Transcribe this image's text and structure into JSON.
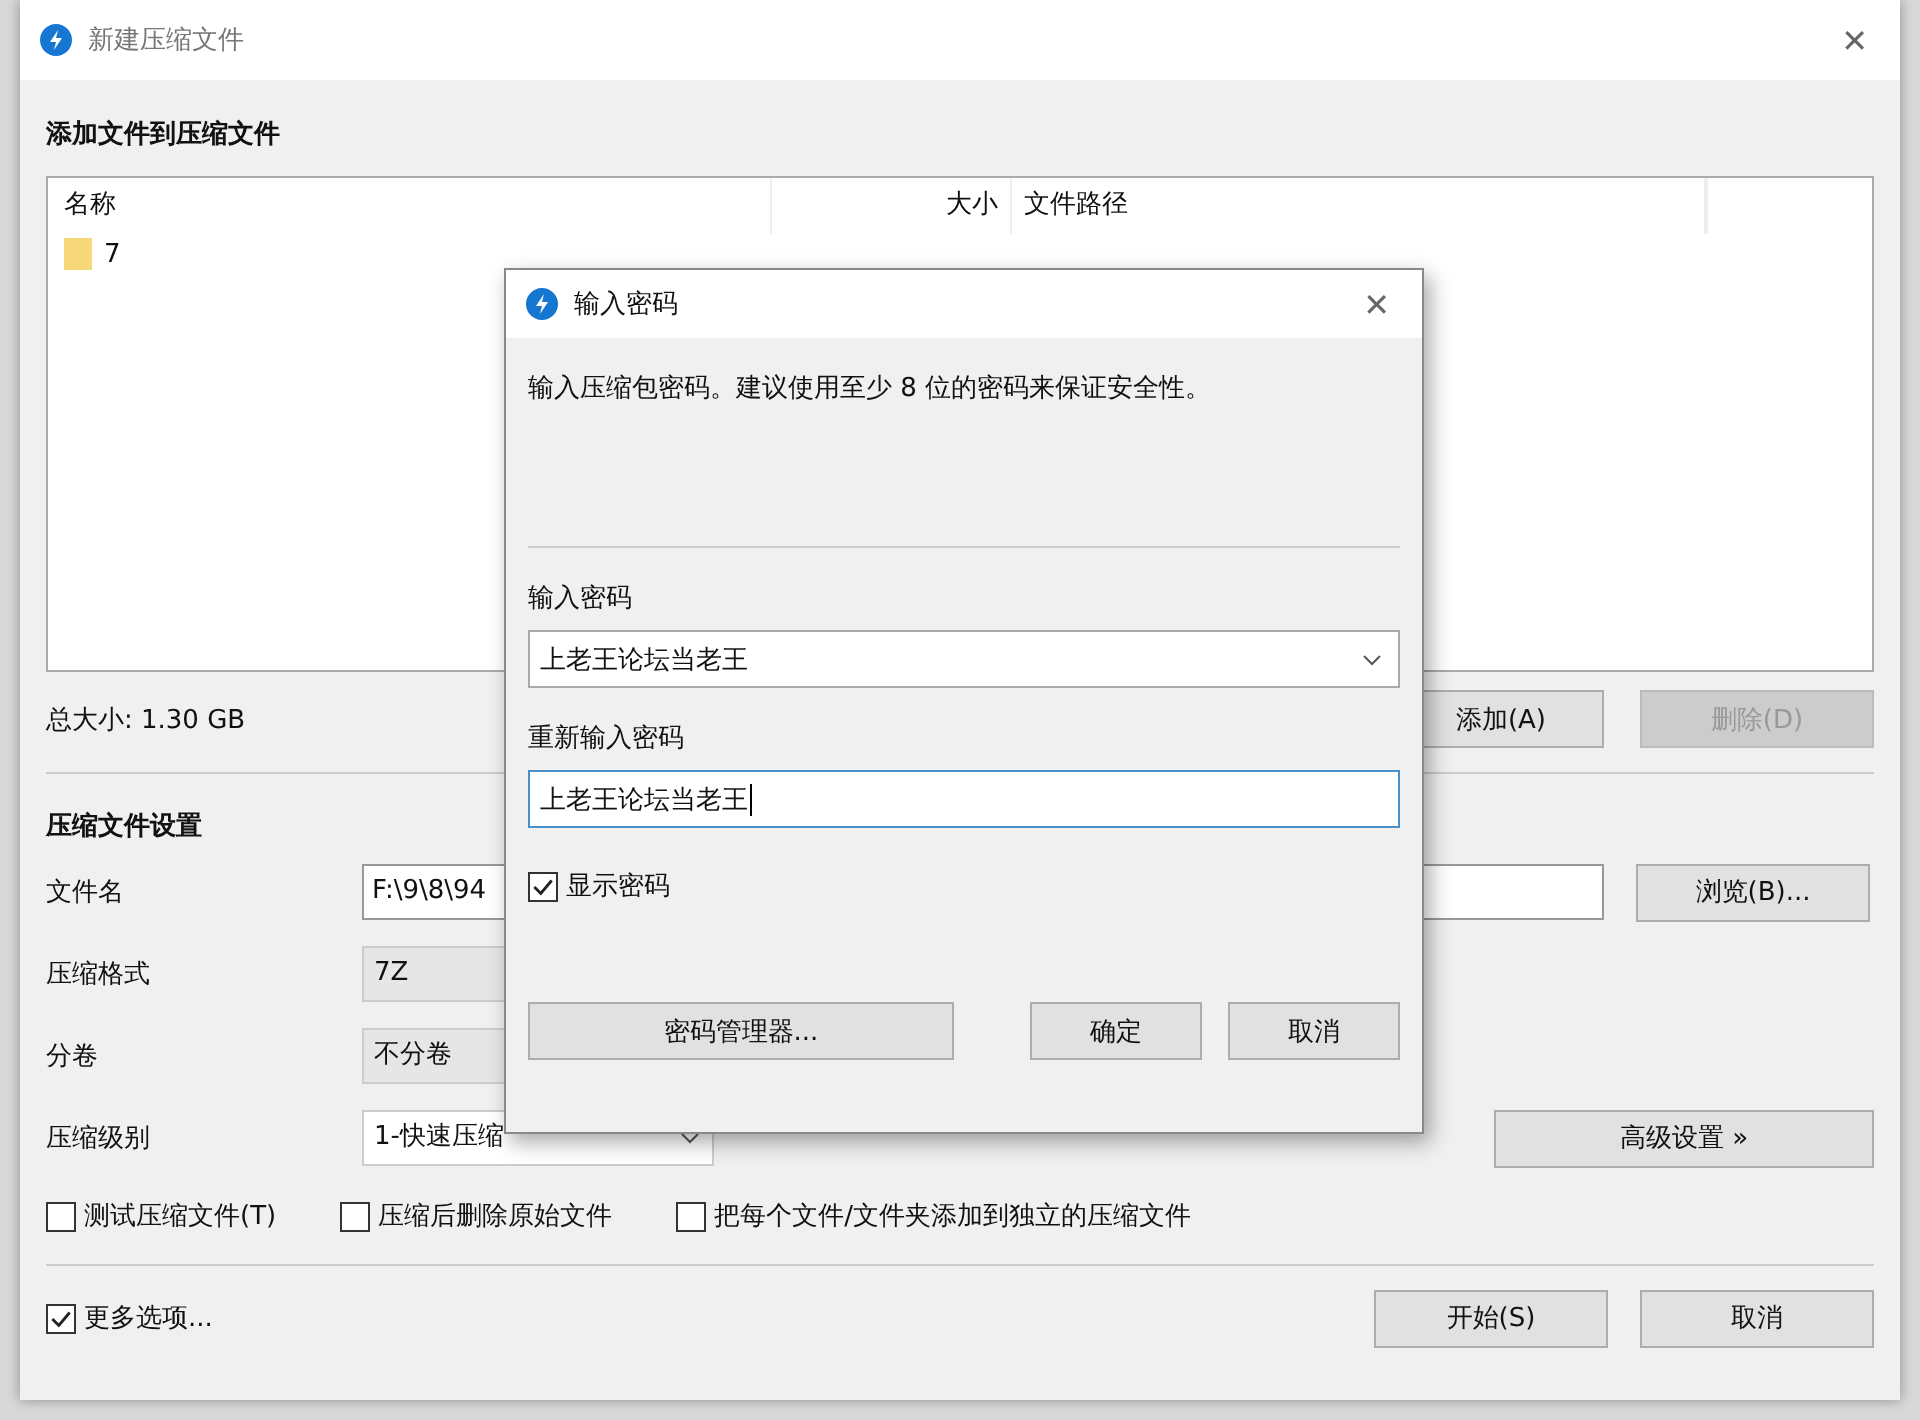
{
  "window": {
    "title": "新建压缩文件",
    "close": "✕"
  },
  "add_section": {
    "heading": "添加文件到压缩文件",
    "columns": [
      "名称",
      "大小",
      "文件路径"
    ],
    "rows": [
      {
        "name": "7"
      }
    ],
    "total_size": "总大小: 1.30 GB",
    "buttons": [
      {
        "label": "添加(A)",
        "disabled": false
      },
      {
        "label": "删除(D)",
        "disabled": true
      }
    ]
  },
  "settings": {
    "heading": "压缩文件设置",
    "fields": [
      {
        "kind": "input",
        "label": "文件名",
        "value": "F:\\9\\8\\94",
        "button": "浏览(B)..."
      },
      {
        "kind": "select",
        "label": "压缩格式",
        "value": "7Z",
        "disabled": true
      },
      {
        "kind": "select",
        "label": "分卷",
        "value": "不分卷",
        "disabled": true
      },
      {
        "kind": "dropdown",
        "label": "压缩级别",
        "value": "1-快速压缩",
        "disabled": false,
        "button": "高级设置 »"
      }
    ],
    "options": [
      {
        "label": "测试压缩文件(T)",
        "checked": false
      },
      {
        "label": "压缩后删除原始文件",
        "checked": false
      },
      {
        "label": "把每个文件/文件夹添加到独立的压缩文件",
        "checked": false
      }
    ]
  },
  "more_options": {
    "label": "更多选项...",
    "checked": true
  },
  "footer_buttons": [
    "开始(S)",
    "取消"
  ],
  "dialog": {
    "title": "输入密码",
    "close": "✕",
    "message": "输入压缩包密码。建议使用至少 8 位的密码来保证安全性。",
    "password_label": "输入密码",
    "password_value": "上老王论坛当老王",
    "confirm_label": "重新输入密码",
    "confirm_value": "上老王论坛当老王",
    "confirm_focused": true,
    "show_password": {
      "label": "显示密码",
      "checked": true
    },
    "manager_button": "密码管理器...",
    "buttons": [
      "确定",
      "取消"
    ]
  }
}
